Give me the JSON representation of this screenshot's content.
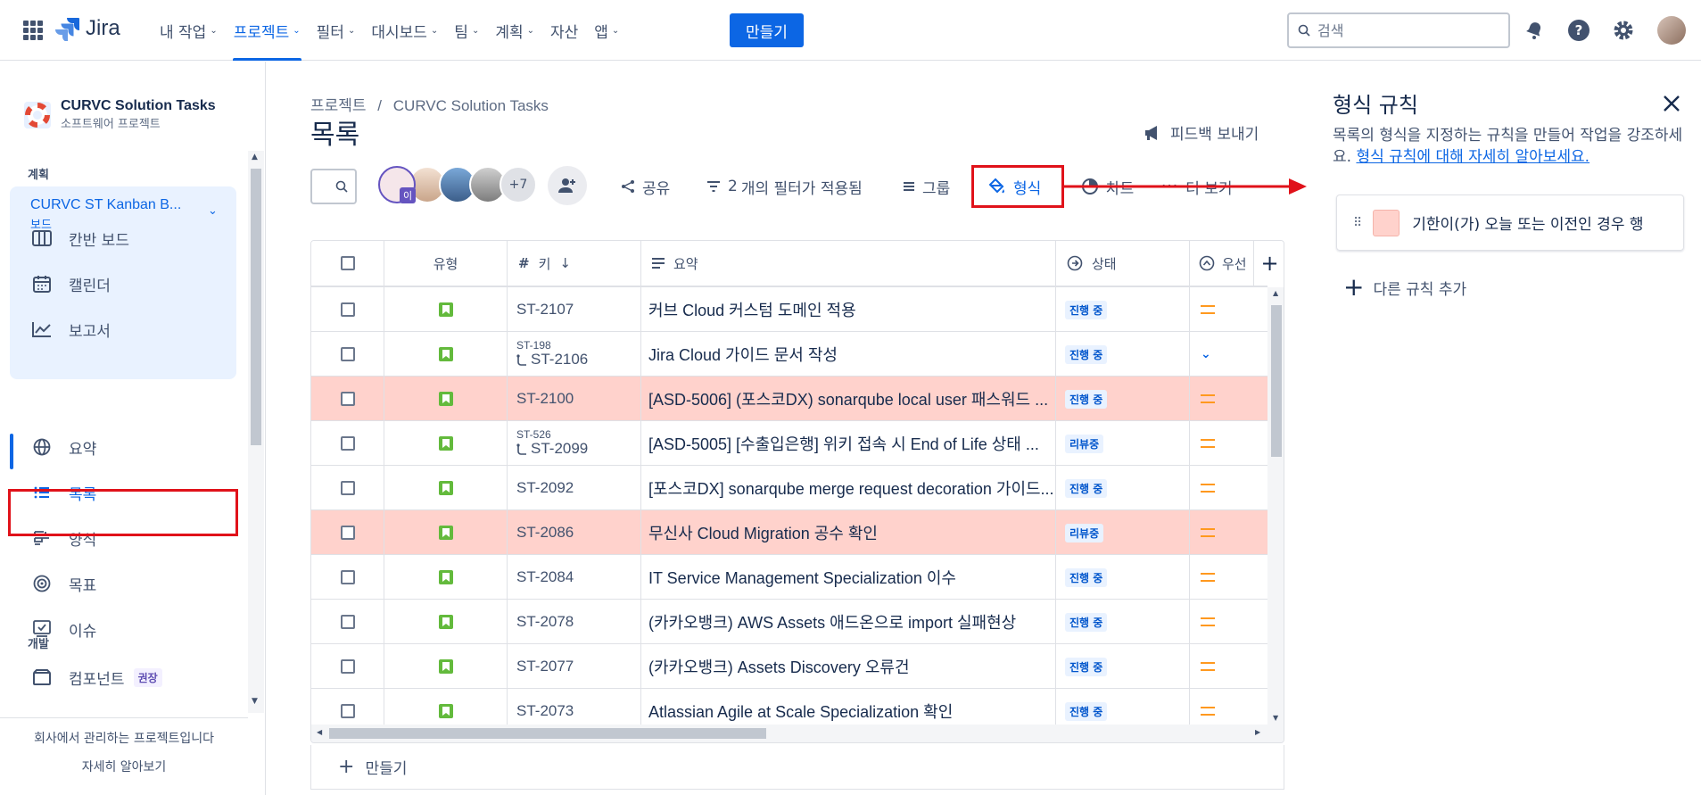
{
  "topnav": {
    "brand": "Jira",
    "items": [
      {
        "label": "내 작업",
        "chevron": true,
        "active": false
      },
      {
        "label": "프로젝트",
        "chevron": true,
        "active": true
      },
      {
        "label": "필터",
        "chevron": true,
        "active": false
      },
      {
        "label": "대시보드",
        "chevron": true,
        "active": false
      },
      {
        "label": "팀",
        "chevron": true,
        "active": false
      },
      {
        "label": "계획",
        "chevron": true,
        "active": false
      },
      {
        "label": "자산",
        "chevron": false,
        "active": false
      },
      {
        "label": "앱",
        "chevron": true,
        "active": false
      }
    ],
    "create_label": "만들기",
    "search_placeholder": "검색"
  },
  "sidebar": {
    "project_name": "CURVC Solution Tasks",
    "project_type": "소프트웨어 프로젝트",
    "section_plan": "계획",
    "board_name": "CURVC ST Kanban B...",
    "board_type": "보드",
    "board_items": [
      {
        "label": "칸반 보드",
        "icon": "board-icon"
      },
      {
        "label": "캘린더",
        "icon": "calendar-icon"
      },
      {
        "label": "보고서",
        "icon": "reports-icon"
      }
    ],
    "nav_items": [
      {
        "label": "요약",
        "icon": "globe-icon",
        "active": false
      },
      {
        "label": "목록",
        "icon": "list-icon",
        "active": true
      },
      {
        "label": "양식",
        "icon": "form-icon",
        "active": false
      },
      {
        "label": "목표",
        "icon": "goal-icon",
        "active": false
      },
      {
        "label": "이슈",
        "icon": "issue-icon",
        "active": false
      }
    ],
    "section_dev": "개발",
    "components_label": "컴포넌트",
    "components_badge": "권장",
    "footer_line1": "회사에서 관리하는 프로젝트입니다",
    "footer_line2": "자세히 알아보기"
  },
  "main": {
    "breadcrumb_root": "프로젝트",
    "breadcrumb_sep": "/",
    "breadcrumb_project": "CURVC Solution Tasks",
    "title": "목록",
    "feedback_label": "피드백 보내기",
    "avatar_extra": "+7",
    "avatar_badge": "이",
    "toolbar": {
      "share": "공유",
      "filter_count": "2",
      "filter_suffix": "개의 필터가 적용됨",
      "group": "그룹",
      "format": "형식",
      "chart": "차트",
      "more": "더 보기"
    },
    "columns": {
      "type": "유형",
      "key": "키",
      "summary": "요약",
      "status": "상태",
      "priority": "우선"
    },
    "rows": [
      {
        "key": "ST-2107",
        "parent": "",
        "summary": "커브 Cloud 커스텀 도메인 적용",
        "status": "진행 중",
        "priority": "medium",
        "highlight": false
      },
      {
        "key": "ST-2106",
        "parent": "ST-198",
        "summary": "Jira Cloud 가이드 문서 작성",
        "status": "진행 중",
        "priority": "low",
        "highlight": false
      },
      {
        "key": "ST-2100",
        "parent": "",
        "summary": "[ASD-5006] (포스코DX) sonarqube local user 패스워드 ...",
        "status": "진행 중",
        "priority": "medium",
        "highlight": true
      },
      {
        "key": "ST-2099",
        "parent": "ST-526",
        "summary": "[ASD-5005] [수출입은행] 위키 접속 시 End of Life 상태 ...",
        "status": "리뷰중",
        "priority": "medium",
        "highlight": false
      },
      {
        "key": "ST-2092",
        "parent": "",
        "summary": "[포스코DX] sonarqube merge request decoration 가이드...",
        "status": "진행 중",
        "priority": "medium",
        "highlight": false
      },
      {
        "key": "ST-2086",
        "parent": "",
        "summary": "무신사 Cloud Migration 공수 확인",
        "status": "리뷰중",
        "priority": "medium",
        "highlight": true
      },
      {
        "key": "ST-2084",
        "parent": "",
        "summary": "IT Service Management Specialization 이수",
        "status": "진행 중",
        "priority": "medium",
        "highlight": false
      },
      {
        "key": "ST-2078",
        "parent": "",
        "summary": "(카카오뱅크) AWS Assets 애드온으로 import 실패현상",
        "status": "진행 중",
        "priority": "medium",
        "highlight": false
      },
      {
        "key": "ST-2077",
        "parent": "",
        "summary": "(카카오뱅크) Assets Discovery 오류건",
        "status": "진행 중",
        "priority": "medium",
        "highlight": false
      },
      {
        "key": "ST-2073",
        "parent": "",
        "summary": "Atlassian Agile at Scale Specialization 확인",
        "status": "진행 중",
        "priority": "medium",
        "highlight": false
      }
    ],
    "create_label": "만들기"
  },
  "panel": {
    "title": "형식 규칙",
    "desc_text": "목록의 형식을 지정하는 규칙을 만들어 작업을 강조하세요.",
    "desc_link": "형식 규칙에 대해 자세히 알아보세요.",
    "rule_text": "기한이(가) 오늘 또는 이전인 경우 행",
    "add_rule": "다른 규칙 추가"
  },
  "colors": {
    "accent": "#0c66e4",
    "highlight_row": "#ffd2cc",
    "annotation_red": "#e0121a"
  }
}
